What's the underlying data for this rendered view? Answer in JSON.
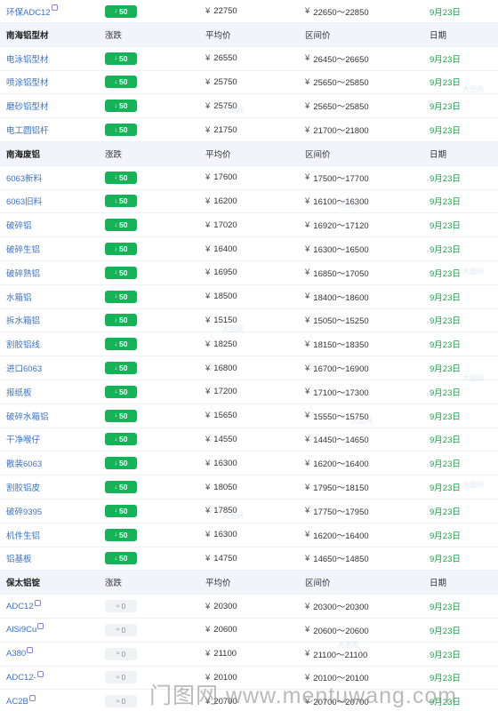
{
  "rows": [
    {
      "kind": "item",
      "name": "环保ADC12",
      "mark": true,
      "change": "50",
      "dir": "down",
      "avg": "22750",
      "range": "22650～22850",
      "date": "9月23日"
    },
    {
      "kind": "header",
      "title": "南海铝型材",
      "cols": [
        "涨跌",
        "平均价",
        "区间价",
        "日期"
      ]
    },
    {
      "kind": "item",
      "name": "电泳铝型材",
      "mark": false,
      "change": "50",
      "dir": "down",
      "avg": "26550",
      "range": "26450～26650",
      "date": "9月23日"
    },
    {
      "kind": "item",
      "name": "喷涂铝型材",
      "mark": false,
      "change": "50",
      "dir": "down",
      "avg": "25750",
      "range": "25650～25850",
      "date": "9月23日"
    },
    {
      "kind": "item",
      "name": "磨砂铝型材",
      "mark": false,
      "change": "50",
      "dir": "down",
      "avg": "25750",
      "range": "25650～25850",
      "date": "9月23日"
    },
    {
      "kind": "item",
      "name": "电工圆铝杆",
      "mark": false,
      "change": "50",
      "dir": "down",
      "avg": "21750",
      "range": "21700～21800",
      "date": "9月23日"
    },
    {
      "kind": "header",
      "title": "南海废铝",
      "cols": [
        "涨跌",
        "平均价",
        "区间价",
        "日期"
      ]
    },
    {
      "kind": "item",
      "name": "6063新料",
      "mark": false,
      "change": "50",
      "dir": "down",
      "avg": "17600",
      "range": "17500～17700",
      "date": "9月23日"
    },
    {
      "kind": "item",
      "name": "6063旧料",
      "mark": false,
      "change": "50",
      "dir": "down",
      "avg": "16200",
      "range": "16100～16300",
      "date": "9月23日"
    },
    {
      "kind": "item",
      "name": "破碎铝",
      "mark": false,
      "change": "50",
      "dir": "down",
      "avg": "17020",
      "range": "16920～17120",
      "date": "9月23日"
    },
    {
      "kind": "item",
      "name": "破碎生铝",
      "mark": false,
      "change": "50",
      "dir": "down",
      "avg": "16400",
      "range": "16300～16500",
      "date": "9月23日"
    },
    {
      "kind": "item",
      "name": "破碎熟铝",
      "mark": false,
      "change": "50",
      "dir": "down",
      "avg": "16950",
      "range": "16850～17050",
      "date": "9月23日"
    },
    {
      "kind": "item",
      "name": "水箱铝",
      "mark": false,
      "change": "50",
      "dir": "down",
      "avg": "18500",
      "range": "18400～18600",
      "date": "9月23日"
    },
    {
      "kind": "item",
      "name": "拆水箱铝",
      "mark": false,
      "change": "50",
      "dir": "down",
      "avg": "15150",
      "range": "15050～15250",
      "date": "9月23日"
    },
    {
      "kind": "item",
      "name": "割胶铝线",
      "mark": false,
      "change": "50",
      "dir": "down",
      "avg": "18250",
      "range": "18150～18350",
      "date": "9月23日"
    },
    {
      "kind": "item",
      "name": "进口6063",
      "mark": false,
      "change": "50",
      "dir": "down",
      "avg": "16800",
      "range": "16700～16900",
      "date": "9月23日"
    },
    {
      "kind": "item",
      "name": "报纸板",
      "mark": false,
      "change": "50",
      "dir": "down",
      "avg": "17200",
      "range": "17100～17300",
      "date": "9月23日"
    },
    {
      "kind": "item",
      "name": "破碎水箱铝",
      "mark": false,
      "change": "50",
      "dir": "down",
      "avg": "15650",
      "range": "15550～15750",
      "date": "9月23日"
    },
    {
      "kind": "item",
      "name": "干净喉仔",
      "mark": false,
      "change": "50",
      "dir": "down",
      "avg": "14550",
      "range": "14450～14650",
      "date": "9月23日"
    },
    {
      "kind": "item",
      "name": "散装6063",
      "mark": false,
      "change": "50",
      "dir": "down",
      "avg": "16300",
      "range": "16200～16400",
      "date": "9月23日"
    },
    {
      "kind": "item",
      "name": "割胶铝皮",
      "mark": false,
      "change": "50",
      "dir": "down",
      "avg": "18050",
      "range": "17950～18150",
      "date": "9月23日"
    },
    {
      "kind": "item",
      "name": "破碎9395",
      "mark": false,
      "change": "50",
      "dir": "down",
      "avg": "17850",
      "range": "17750～17950",
      "date": "9月23日"
    },
    {
      "kind": "item",
      "name": "机件生铝",
      "mark": false,
      "change": "50",
      "dir": "down",
      "avg": "16300",
      "range": "16200～16400",
      "date": "9月23日"
    },
    {
      "kind": "item",
      "name": "铝基板",
      "mark": false,
      "change": "50",
      "dir": "down",
      "avg": "14750",
      "range": "14650～14850",
      "date": "9月23日"
    },
    {
      "kind": "header",
      "title": "保太铝锭",
      "cols": [
        "涨跌",
        "平均价",
        "区间价",
        "日期"
      ]
    },
    {
      "kind": "item",
      "name": "ADC12",
      "mark": true,
      "change": "0",
      "dir": "flat",
      "avg": "20300",
      "range": "20300～20300",
      "date": "9月23日"
    },
    {
      "kind": "item",
      "name": "AlSi9Cu",
      "mark": true,
      "change": "0",
      "dir": "flat",
      "avg": "20600",
      "range": "20600～20600",
      "date": "9月23日"
    },
    {
      "kind": "item",
      "name": "A380",
      "mark": true,
      "change": "0",
      "dir": "flat",
      "avg": "21100",
      "range": "21100～21100",
      "date": "9月23日"
    },
    {
      "kind": "item",
      "name": "ADC12-",
      "mark": true,
      "change": "0",
      "dir": "flat",
      "avg": "20100",
      "range": "20100～20100",
      "date": "9月23日"
    },
    {
      "kind": "item",
      "name": "AC2B",
      "mark": true,
      "change": "0",
      "dir": "flat",
      "avg": "20700",
      "range": "20700～20700",
      "date": "9月23日"
    }
  ],
  "currency_symbol": "¥",
  "down_arrow_glyph": "↓",
  "flat_glyph": "≈",
  "watermark_small": "大图网",
  "watermark_big": "门图网 www.mentuwang.com",
  "colors": {
    "link": "#3b73c4",
    "date": "#1aa34a",
    "badge_down": "#14b357",
    "badge_flat": "#f1f2f4",
    "header_bg": "#f3f4fb"
  }
}
